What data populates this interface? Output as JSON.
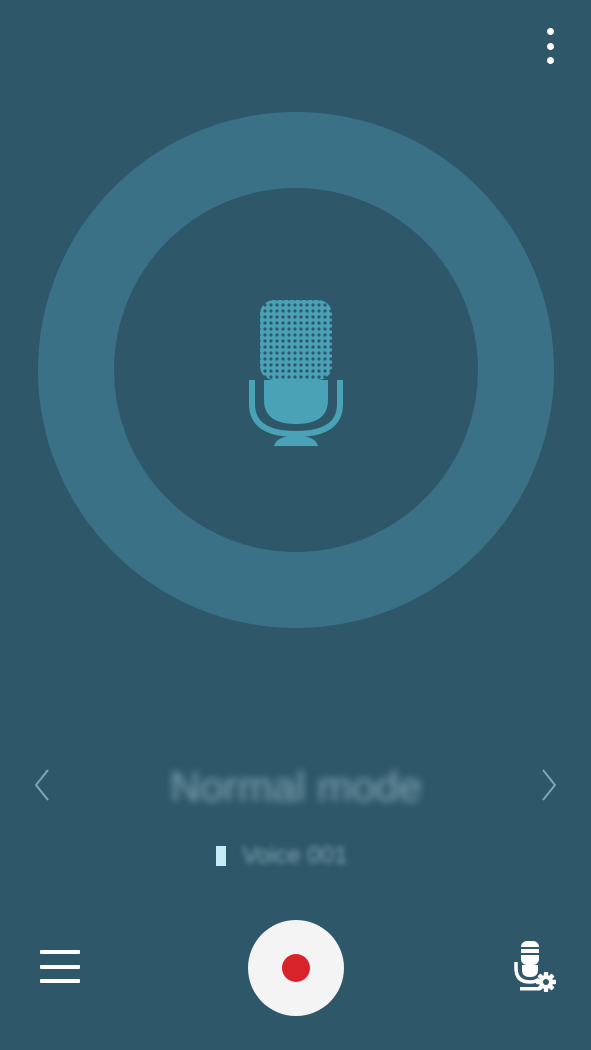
{
  "toolbar": {
    "more_icon": "more-vertical-icon"
  },
  "recorder": {
    "visual_icon": "microphone-icon",
    "ring_color": "#3b7186",
    "background_color": "#2e5769"
  },
  "mode": {
    "label": "Normal mode",
    "prev_icon": "chevron-left-icon",
    "next_icon": "chevron-right-icon"
  },
  "status": {
    "text": "Voice 001"
  },
  "bottom_bar": {
    "menu_icon": "hamburger-menu-icon",
    "record_icon": "record-icon",
    "record_color": "#d9232b",
    "settings_icon": "microphone-settings-icon"
  }
}
